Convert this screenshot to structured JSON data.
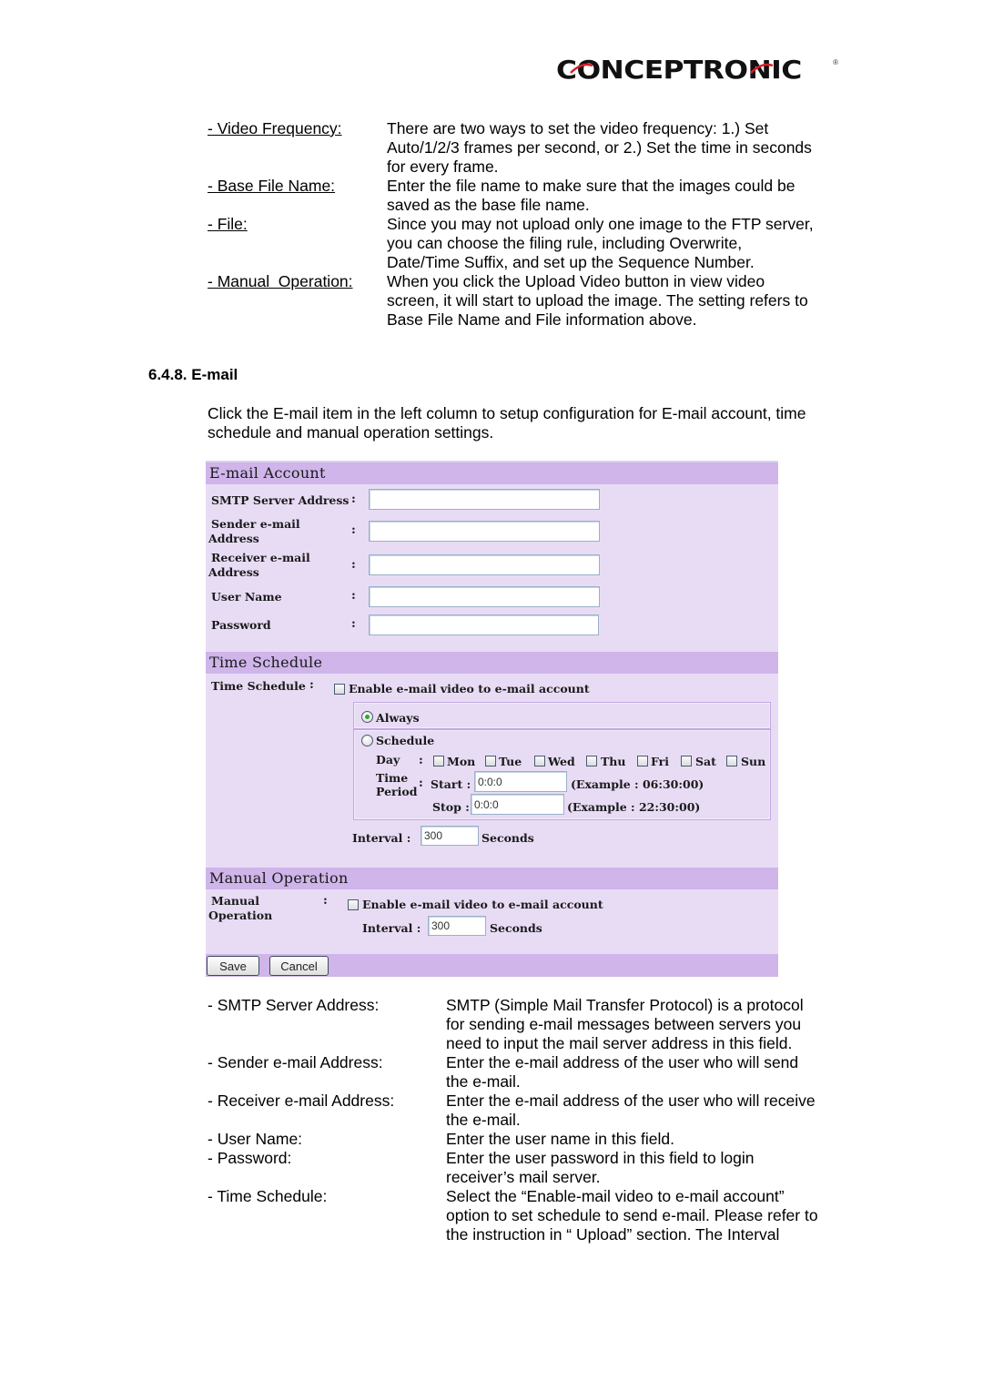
{
  "brand": {
    "logo_text": "CONCEPTRONIC",
    "registered_mark": "®",
    "accent_color": "#d42027"
  },
  "upload_definitions": [
    {
      "term": "- Video Frequency:",
      "lines": [
        "There are two ways to set the video frequency: 1.) Set",
        "Auto/1/2/3 frames per second, or 2.) Set the time in seconds",
        "for every frame."
      ]
    },
    {
      "term": "- Base File Name:",
      "lines": [
        "Enter the file name to make sure that the images could be",
        "saved as the base file name."
      ]
    },
    {
      "term": "- File:",
      "lines": [
        "Since you may not upload only one image to the FTP server,",
        "you can choose the filing rule, including Overwrite,",
        "Date/Time Suffix, and set up the Sequence Number."
      ]
    },
    {
      "term": "- Manual  Operation:",
      "lines": [
        "When you click the Upload Video button in view video",
        "screen, it will start to upload the image. The setting refers to",
        "Base File Name and File information above."
      ]
    }
  ],
  "section": {
    "heading": "6.4.8. E-mail",
    "intro_lines": [
      "Click the E-mail item in the left column to setup configuration for E-mail account, time",
      "schedule and manual operation settings."
    ]
  },
  "panel": {
    "colors": {
      "header_bg": "#cfb5ea",
      "body_bg": "#e8dcf5"
    },
    "email_account": {
      "title": "E-mail Account",
      "colon": ":",
      "fields": [
        {
          "label_l1": "SMTP Server Address",
          "label_l2": "",
          "value": ""
        },
        {
          "label_l1": "Sender e-mail",
          "label_l2": "Address",
          "value": ""
        },
        {
          "label_l1": "Receiver e-mail",
          "label_l2": "Address",
          "value": ""
        },
        {
          "label_l1": "User Name",
          "label_l2": "",
          "value": ""
        },
        {
          "label_l1": "Password",
          "label_l2": "",
          "value": ""
        }
      ]
    },
    "time_schedule": {
      "title": "Time Schedule",
      "label": "Time Schedule",
      "colon": ":",
      "enable_label": "Enable e-mail video to e-mail account",
      "enable_checked": false,
      "always_label": "Always",
      "always_selected": true,
      "schedule_label": "Schedule",
      "schedule_selected": false,
      "day_label": "Day",
      "days": [
        {
          "label": "Mon",
          "checked": false
        },
        {
          "label": "Tue",
          "checked": false
        },
        {
          "label": "Wed",
          "checked": false
        },
        {
          "label": "Thu",
          "checked": false
        },
        {
          "label": "Fri",
          "checked": false
        },
        {
          "label": "Sat",
          "checked": false
        },
        {
          "label": "Sun",
          "checked": false
        }
      ],
      "time_period_l1": "Time",
      "time_period_l2": "Period",
      "start_label": "Start :",
      "start_value": "0:0:0",
      "start_example": "(Example : 06:30:00)",
      "stop_label": "Stop :",
      "stop_value": "0:0:0",
      "stop_example": "(Example : 22:30:00)",
      "interval_label": "Interval :",
      "interval_value": "300",
      "interval_unit": "Seconds"
    },
    "manual_operation": {
      "title": "Manual Operation",
      "label_l1": "Manual",
      "label_l2": "Operation",
      "colon": ":",
      "enable_label": "Enable e-mail video to e-mail account",
      "enable_checked": false,
      "interval_label": "Interval :",
      "interval_value": "300",
      "interval_unit": "Seconds"
    },
    "buttons": {
      "save": "Save",
      "cancel": "Cancel"
    }
  },
  "email_definitions": [
    {
      "term": "- SMTP Server Address:",
      "lines": [
        "SMTP (Simple Mail Transfer Protocol) is a protocol",
        "for sending e-mail messages between servers you",
        "need to input the mail server address in this field."
      ]
    },
    {
      "term": "- Sender e-mail Address:",
      "lines": [
        "Enter the e-mail address of the user who will send",
        "the e-mail."
      ]
    },
    {
      "term": "- Receiver e-mail Address:",
      "lines": [
        "Enter the e-mail address of the user who will receive",
        "the e-mail."
      ]
    },
    {
      "term": "- User Name:",
      "lines": [
        "Enter the user name in this field."
      ]
    },
    {
      "term": "- Password:",
      "lines": [
        "Enter the user password in this field to login",
        "receiver’s mail server."
      ]
    },
    {
      "term": "- Time Schedule:",
      "lines": [
        "Select the “Enable-mail video to e-mail account”",
        "option to set schedule to send e-mail. Please refer to",
        "the instruction in “ Upload” section. The Interval"
      ]
    }
  ]
}
